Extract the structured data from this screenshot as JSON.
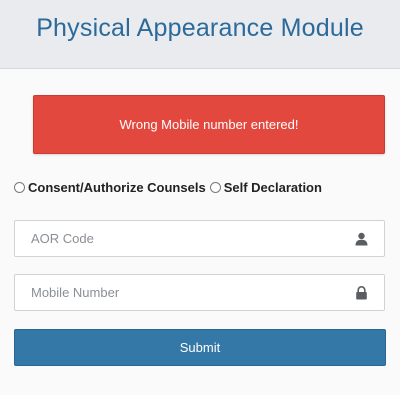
{
  "header": {
    "title": "Physical Appearance Module"
  },
  "alert": {
    "message": "Wrong Mobile number entered!"
  },
  "radio_options": [
    {
      "label": "Consent/Authorize Counsels",
      "selected": false
    },
    {
      "label": "Self Declaration",
      "selected": false
    }
  ],
  "fields": {
    "aor_code": {
      "placeholder": "AOR Code",
      "value": "",
      "icon": "user-icon"
    },
    "mobile_number": {
      "placeholder": "Mobile Number",
      "value": "",
      "icon": "lock-icon"
    }
  },
  "submit": {
    "label": "Submit"
  },
  "colors": {
    "title": "#2c6a9b",
    "alert_bg": "#e2483e",
    "button_bg": "#3378a6"
  }
}
